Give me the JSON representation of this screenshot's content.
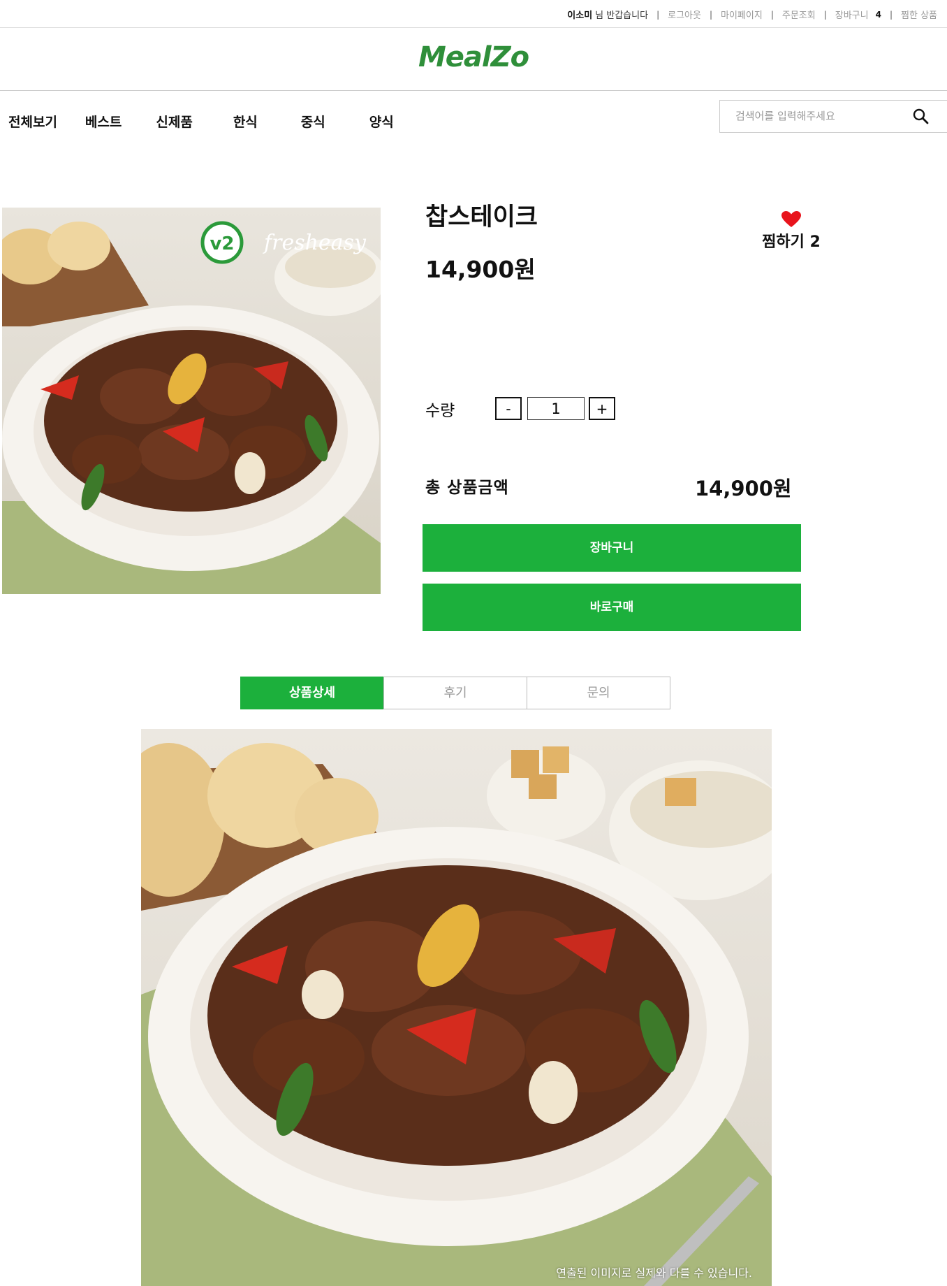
{
  "top_bar": {
    "user_name": "이소미",
    "greeting": "님 반갑습니다",
    "links": {
      "logout": "로그아웃",
      "mypage": "마이페이지",
      "orders": "주문조회",
      "cart": "장바구니",
      "wishlist": "찜한 상품"
    },
    "cart_count": "4"
  },
  "logo": "MealZo",
  "nav": {
    "categories": [
      "전체보기",
      "베스트",
      "신제품",
      "한식",
      "중식",
      "양식"
    ]
  },
  "search": {
    "placeholder": "검색어를 입력해주세요",
    "icon": "search-icon"
  },
  "product": {
    "title": "찹스테이크",
    "price": "14,900원",
    "wish_label": "찜하기 2",
    "quantity_label": "수량",
    "quantity": "1",
    "minus_label": "-",
    "plus_label": "+",
    "total_label": "총 상품금액",
    "total_price": "14,900원",
    "cart_button": "장바구니",
    "buy_button": "바로구매",
    "image_badge": "fresheasy",
    "image_badge_logo": "v2"
  },
  "tabs": [
    {
      "label": "상품상세",
      "active": true
    },
    {
      "label": "후기",
      "active": false
    },
    {
      "label": "문의",
      "active": false
    }
  ],
  "detail": {
    "caption": "연출된 이미지로 실제와 다를 수 있습니다."
  },
  "colors": {
    "accent": "#1cb03c",
    "logo": "#2f8f3a",
    "heart": "#e8141c"
  }
}
